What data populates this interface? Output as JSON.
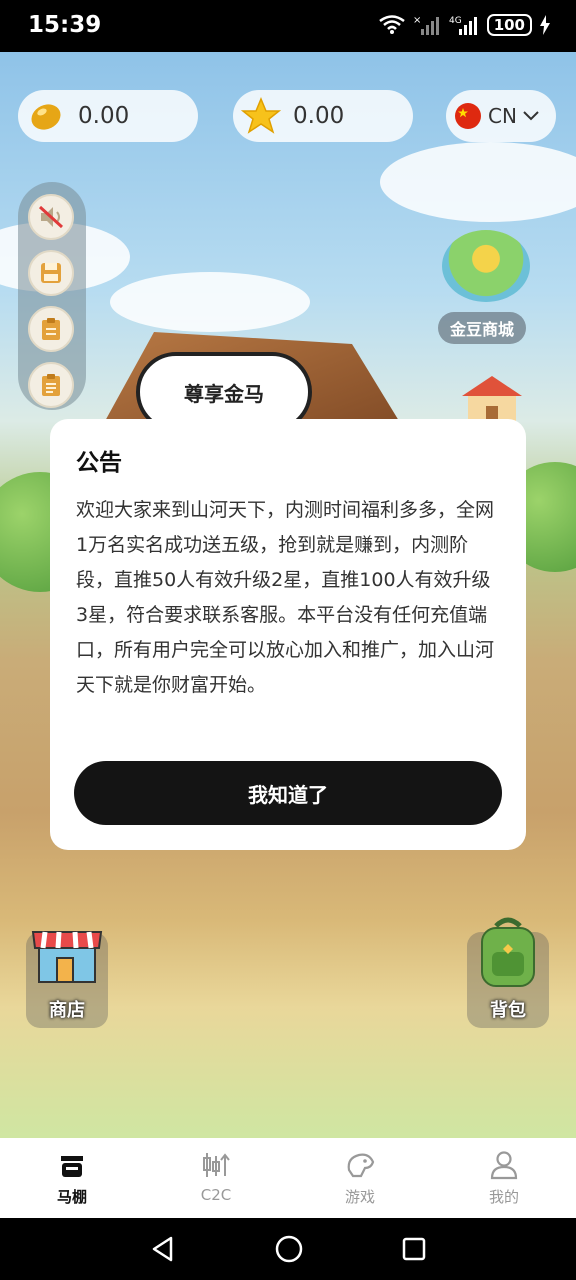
{
  "status_bar": {
    "time": "15:39",
    "battery": "100"
  },
  "top_bar": {
    "beans_value": "0.00",
    "stars_value": "0.00",
    "language": "CN",
    "bean_icon": "golden-bean-icon",
    "star_icon": "star-icon",
    "flag_icon": "china-flag-icon"
  },
  "side_toolbar": {
    "items": [
      "mute-icon",
      "save-icon",
      "notes-icon",
      "clipboard-icon"
    ]
  },
  "scene": {
    "vip_label": "尊享金马",
    "gold_bean_mall_label": "金豆商城",
    "shop_label": "商店",
    "backpack_label": "背包"
  },
  "modal": {
    "title": "公告",
    "body": "欢迎大家来到山河天下，内测时间福利多多，全网1万名实名成功送五级，抢到就是赚到，内测阶段，直推50人有效升级2星，直推100人有效升级3星，符合要求联系客服。本平台没有任何充值端口，所有用户完全可以放心加入和推广，加入山河天下就是你财富开始。",
    "confirm_label": "我知道了"
  },
  "tabs": [
    {
      "label": "马棚",
      "icon": "stable-icon",
      "active": true
    },
    {
      "label": "C2C",
      "icon": "candlestick-icon",
      "active": false
    },
    {
      "label": "游戏",
      "icon": "horse-head-icon",
      "active": false
    },
    {
      "label": "我的",
      "icon": "profile-icon",
      "active": false
    }
  ],
  "colors": {
    "modal_button": "#141414",
    "tab_active": "#111111",
    "tab_inactive": "#999999"
  }
}
